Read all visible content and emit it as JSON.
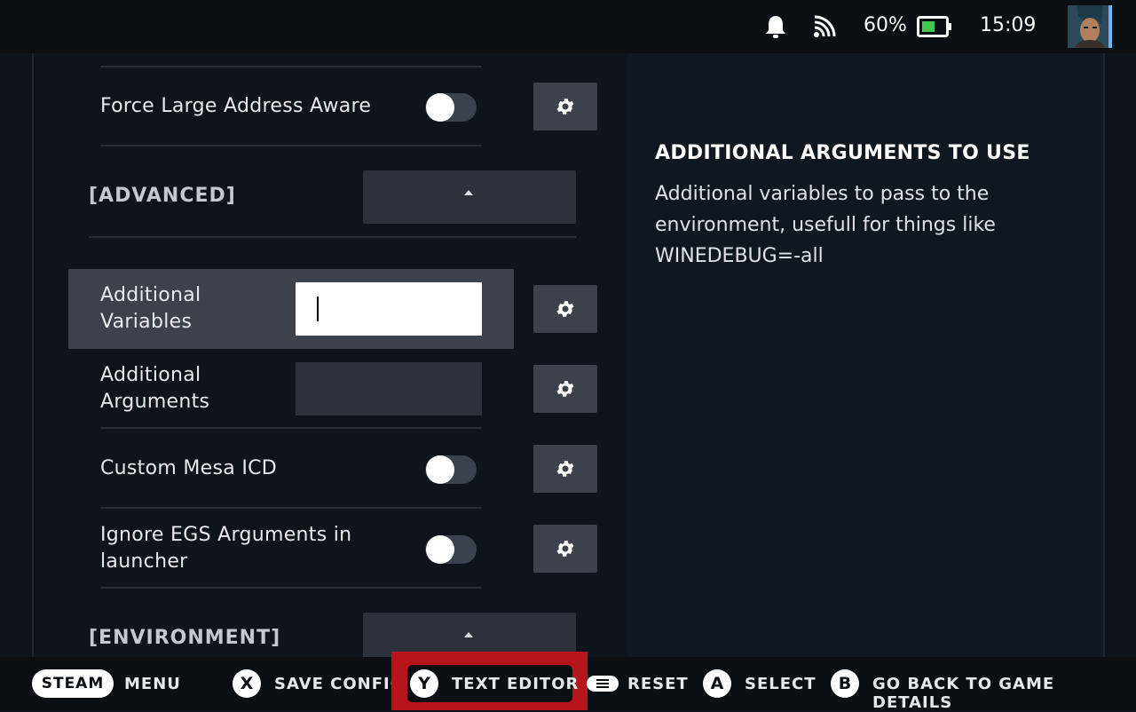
{
  "status_bar": {
    "battery_percent": "60%",
    "time": "15:09",
    "icons": [
      "bell-icon",
      "wifi-icon",
      "battery-icon",
      "avatar"
    ]
  },
  "settings": {
    "force_large_address_aware": {
      "label": "Force Large Address Aware",
      "enabled": false
    },
    "advanced_section": {
      "label": "[ADVANCED]",
      "expanded": true
    },
    "additional_variables": {
      "label_line1": "Additional",
      "label_line2": "Variables",
      "value": ""
    },
    "additional_arguments": {
      "label_line1": "Additional",
      "label_line2": "Arguments",
      "value": ""
    },
    "custom_mesa_icd": {
      "label": "Custom Mesa ICD",
      "enabled": false
    },
    "ignore_egs_arguments": {
      "label_line1": "Ignore EGS Arguments in",
      "label_line2": "launcher",
      "enabled": false
    },
    "environment_section": {
      "label": "[ENVIRONMENT]",
      "expanded": true
    }
  },
  "description": {
    "title": "ADDITIONAL ARGUMENTS TO USE",
    "body": "Additional variables to pass to the environment, usefull for things like WINEDEBUG=-all"
  },
  "footer": {
    "steam_pill": "STEAM",
    "menu_label": "MENU",
    "x_button": "X",
    "save_config_label": "SAVE CONFIG",
    "y_button": "Y",
    "text_editor_label": "TEXT EDITOR",
    "reset_label": "RESET",
    "a_button": "A",
    "select_label": "SELECT",
    "b_button": "B",
    "go_back_label": "GO BACK TO GAME DETAILS"
  },
  "colors": {
    "background": "#0e141b",
    "panel": "#0f1821",
    "highlight": "#b5151b",
    "focus_row": "#3b424b"
  }
}
